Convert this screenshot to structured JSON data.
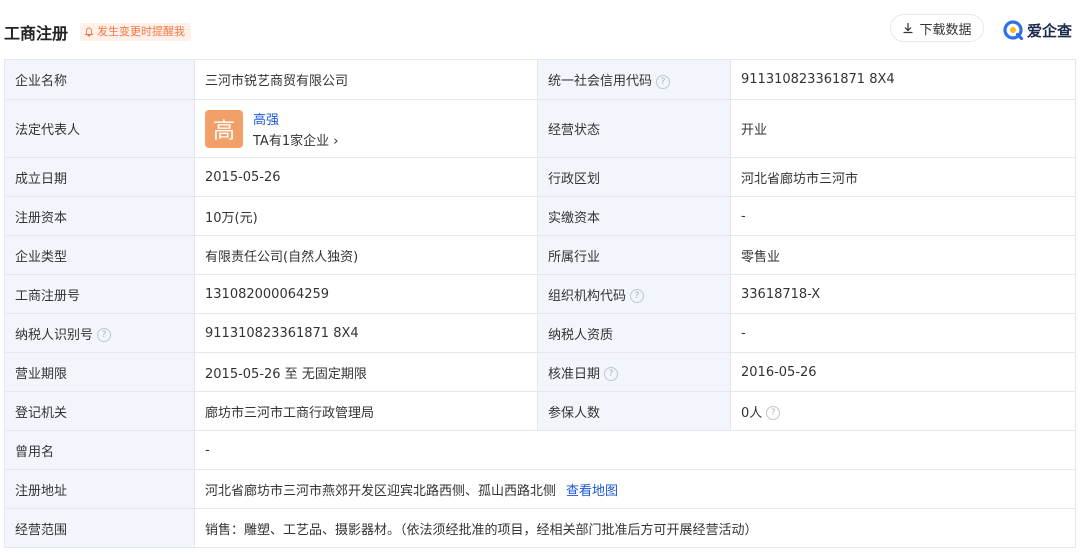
{
  "header": {
    "title": "工商注册",
    "remind_label": "发生变更时提醒我",
    "download_label": "下载数据",
    "brand": "爱企查"
  },
  "rows": {
    "r1": {
      "l1": "企业名称",
      "v1": "三河市锐艺商贸有限公司",
      "l2": "统一社会信用代码",
      "v2": "911310823361871 8X4"
    },
    "r2": {
      "l1": "法定代表人",
      "avatar_char": "高",
      "name": "高强",
      "count": "TA有1家企业",
      "l2": "经营状态",
      "v2": "开业"
    },
    "r3": {
      "l1": "成立日期",
      "v1": "2015-05-26",
      "l2": "行政区划",
      "v2": "河北省廊坊市三河市"
    },
    "r4": {
      "l1": "注册资本",
      "v1": "10万(元)",
      "l2": "实缴资本",
      "v2": "-"
    },
    "r5": {
      "l1": "企业类型",
      "v1": "有限责任公司(自然人独资)",
      "l2": "所属行业",
      "v2": "零售业"
    },
    "r6": {
      "l1": "工商注册号",
      "v1": "131082000064259",
      "l2": "组织机构代码",
      "v2": "33618718-X"
    },
    "r7": {
      "l1": "纳税人识别号",
      "v1": "911310823361871 8X4",
      "l2": "纳税人资质",
      "v2": "-"
    },
    "r8": {
      "l1": "营业期限",
      "v1": "2015-05-26 至 无固定期限",
      "l2": "核准日期",
      "v2": "2016-05-26"
    },
    "r9": {
      "l1": "登记机关",
      "v1": "廊坊市三河市工商行政管理局",
      "l2": "参保人数",
      "v2": "0人"
    },
    "r10": {
      "l1": "曾用名",
      "v1": "-"
    },
    "r11": {
      "l1": "注册地址",
      "v1": "河北省廊坊市三河市燕郊开发区迎宾北路西侧、孤山西路北侧",
      "link": "查看地图"
    },
    "r12": {
      "l1": "经营范围",
      "v1": "销售：雕塑、工艺品、摄影器材。（依法须经批准的项目，经相关部门批准后方可开展经营活动）"
    }
  }
}
